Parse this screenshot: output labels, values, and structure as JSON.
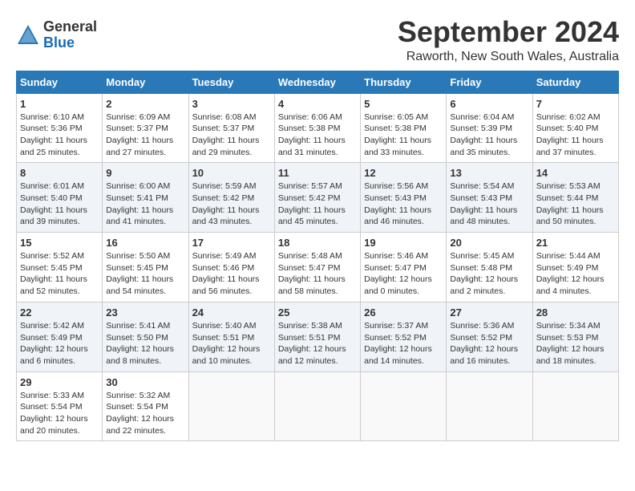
{
  "header": {
    "logo_general": "General",
    "logo_blue": "Blue",
    "month_title": "September 2024",
    "location": "Raworth, New South Wales, Australia"
  },
  "weekdays": [
    "Sunday",
    "Monday",
    "Tuesday",
    "Wednesday",
    "Thursday",
    "Friday",
    "Saturday"
  ],
  "weeks": [
    [
      {
        "day": "1",
        "info": "Sunrise: 6:10 AM\nSunset: 5:36 PM\nDaylight: 11 hours\nand 25 minutes."
      },
      {
        "day": "2",
        "info": "Sunrise: 6:09 AM\nSunset: 5:37 PM\nDaylight: 11 hours\nand 27 minutes."
      },
      {
        "day": "3",
        "info": "Sunrise: 6:08 AM\nSunset: 5:37 PM\nDaylight: 11 hours\nand 29 minutes."
      },
      {
        "day": "4",
        "info": "Sunrise: 6:06 AM\nSunset: 5:38 PM\nDaylight: 11 hours\nand 31 minutes."
      },
      {
        "day": "5",
        "info": "Sunrise: 6:05 AM\nSunset: 5:38 PM\nDaylight: 11 hours\nand 33 minutes."
      },
      {
        "day": "6",
        "info": "Sunrise: 6:04 AM\nSunset: 5:39 PM\nDaylight: 11 hours\nand 35 minutes."
      },
      {
        "day": "7",
        "info": "Sunrise: 6:02 AM\nSunset: 5:40 PM\nDaylight: 11 hours\nand 37 minutes."
      }
    ],
    [
      {
        "day": "8",
        "info": "Sunrise: 6:01 AM\nSunset: 5:40 PM\nDaylight: 11 hours\nand 39 minutes."
      },
      {
        "day": "9",
        "info": "Sunrise: 6:00 AM\nSunset: 5:41 PM\nDaylight: 11 hours\nand 41 minutes."
      },
      {
        "day": "10",
        "info": "Sunrise: 5:59 AM\nSunset: 5:42 PM\nDaylight: 11 hours\nand 43 minutes."
      },
      {
        "day": "11",
        "info": "Sunrise: 5:57 AM\nSunset: 5:42 PM\nDaylight: 11 hours\nand 45 minutes."
      },
      {
        "day": "12",
        "info": "Sunrise: 5:56 AM\nSunset: 5:43 PM\nDaylight: 11 hours\nand 46 minutes."
      },
      {
        "day": "13",
        "info": "Sunrise: 5:54 AM\nSunset: 5:43 PM\nDaylight: 11 hours\nand 48 minutes."
      },
      {
        "day": "14",
        "info": "Sunrise: 5:53 AM\nSunset: 5:44 PM\nDaylight: 11 hours\nand 50 minutes."
      }
    ],
    [
      {
        "day": "15",
        "info": "Sunrise: 5:52 AM\nSunset: 5:45 PM\nDaylight: 11 hours\nand 52 minutes."
      },
      {
        "day": "16",
        "info": "Sunrise: 5:50 AM\nSunset: 5:45 PM\nDaylight: 11 hours\nand 54 minutes."
      },
      {
        "day": "17",
        "info": "Sunrise: 5:49 AM\nSunset: 5:46 PM\nDaylight: 11 hours\nand 56 minutes."
      },
      {
        "day": "18",
        "info": "Sunrise: 5:48 AM\nSunset: 5:47 PM\nDaylight: 11 hours\nand 58 minutes."
      },
      {
        "day": "19",
        "info": "Sunrise: 5:46 AM\nSunset: 5:47 PM\nDaylight: 12 hours\nand 0 minutes."
      },
      {
        "day": "20",
        "info": "Sunrise: 5:45 AM\nSunset: 5:48 PM\nDaylight: 12 hours\nand 2 minutes."
      },
      {
        "day": "21",
        "info": "Sunrise: 5:44 AM\nSunset: 5:49 PM\nDaylight: 12 hours\nand 4 minutes."
      }
    ],
    [
      {
        "day": "22",
        "info": "Sunrise: 5:42 AM\nSunset: 5:49 PM\nDaylight: 12 hours\nand 6 minutes."
      },
      {
        "day": "23",
        "info": "Sunrise: 5:41 AM\nSunset: 5:50 PM\nDaylight: 12 hours\nand 8 minutes."
      },
      {
        "day": "24",
        "info": "Sunrise: 5:40 AM\nSunset: 5:51 PM\nDaylight: 12 hours\nand 10 minutes."
      },
      {
        "day": "25",
        "info": "Sunrise: 5:38 AM\nSunset: 5:51 PM\nDaylight: 12 hours\nand 12 minutes."
      },
      {
        "day": "26",
        "info": "Sunrise: 5:37 AM\nSunset: 5:52 PM\nDaylight: 12 hours\nand 14 minutes."
      },
      {
        "day": "27",
        "info": "Sunrise: 5:36 AM\nSunset: 5:52 PM\nDaylight: 12 hours\nand 16 minutes."
      },
      {
        "day": "28",
        "info": "Sunrise: 5:34 AM\nSunset: 5:53 PM\nDaylight: 12 hours\nand 18 minutes."
      }
    ],
    [
      {
        "day": "29",
        "info": "Sunrise: 5:33 AM\nSunset: 5:54 PM\nDaylight: 12 hours\nand 20 minutes."
      },
      {
        "day": "30",
        "info": "Sunrise: 5:32 AM\nSunset: 5:54 PM\nDaylight: 12 hours\nand 22 minutes."
      },
      {
        "day": "",
        "info": ""
      },
      {
        "day": "",
        "info": ""
      },
      {
        "day": "",
        "info": ""
      },
      {
        "day": "",
        "info": ""
      },
      {
        "day": "",
        "info": ""
      }
    ]
  ]
}
